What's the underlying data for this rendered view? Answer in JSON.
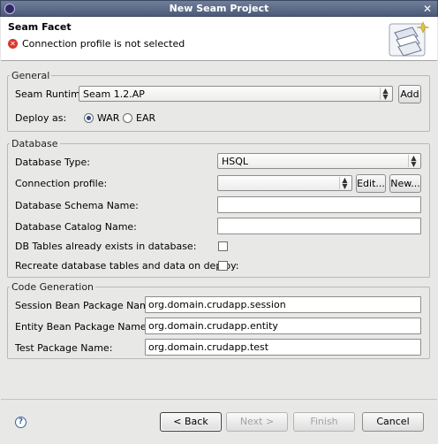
{
  "window": {
    "title": "New Seam Project"
  },
  "header": {
    "title": "Seam Facet",
    "error_message": "Connection profile is not selected",
    "error_icon": "error-icon",
    "banner_icon": "seam-wizard-banner"
  },
  "general": {
    "legend": "General",
    "runtime_label": "Seam Runtime",
    "runtime_value": "Seam 1.2.AP",
    "add_label": "Add",
    "deploy_label": "Deploy as:",
    "deploy_options": [
      "WAR",
      "EAR"
    ],
    "deploy_selected": "WAR"
  },
  "database": {
    "legend": "Database",
    "type_label": "Database Type:",
    "type_value": "HSQL",
    "profile_label": "Connection profile:",
    "profile_value": "",
    "edit_label": "Edit...",
    "new_label": "New...",
    "schema_label": "Database Schema Name:",
    "schema_value": "",
    "catalog_label": "Database Catalog Name:",
    "catalog_value": "",
    "tables_exist_label": "DB Tables already exists in database:",
    "recreate_label": "Recreate database tables and data on deploy:"
  },
  "codegen": {
    "legend": "Code Generation",
    "session_label": "Session Bean Package Name:",
    "session_value": "org.domain.crudapp.session",
    "entity_label": "Entity Bean Package Name:",
    "entity_value": "org.domain.crudapp.entity",
    "test_label": "Test Package Name:",
    "test_value": "org.domain.crudapp.test"
  },
  "footer": {
    "help_icon": "help-icon",
    "back_label": "< Back",
    "next_label": "Next >",
    "finish_label": "Finish",
    "cancel_label": "Cancel"
  }
}
